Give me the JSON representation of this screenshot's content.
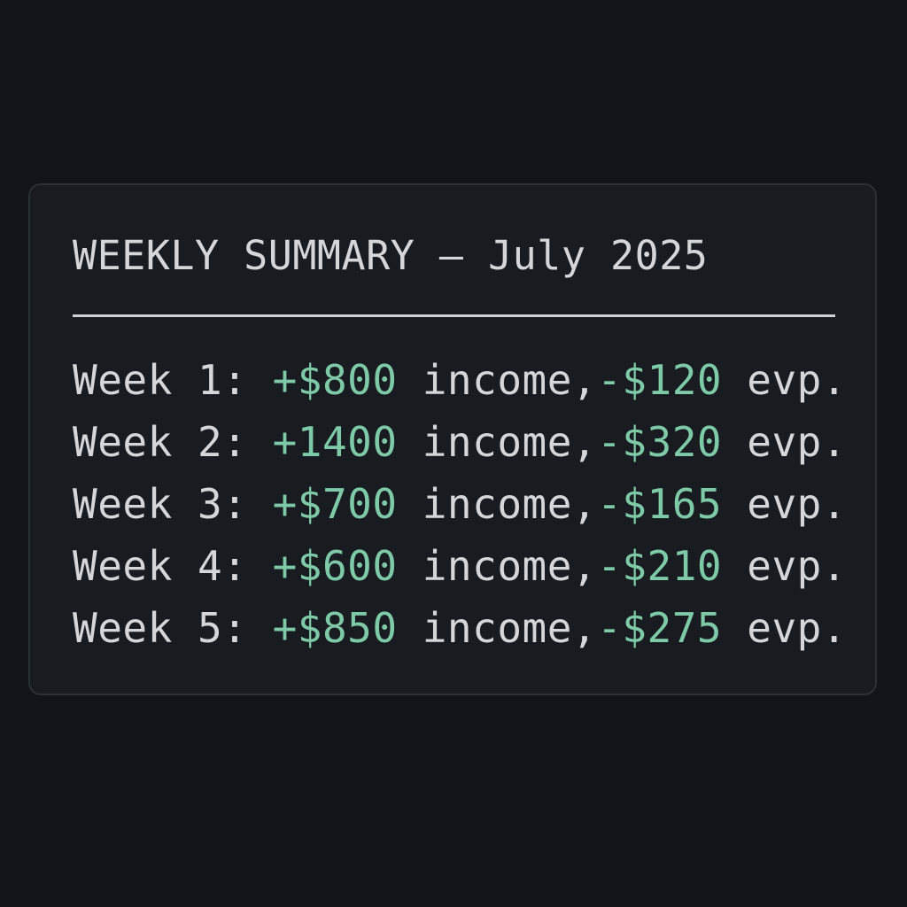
{
  "summary": {
    "title": "WEEKLY SUMMARY — July 2025",
    "rows": [
      {
        "week": "Week 1: ",
        "income": "+$800",
        "income_label": " income,",
        "expense": "-$120",
        "expense_label": " evp."
      },
      {
        "week": "Week 2: ",
        "income": "+1400",
        "income_label": " income,",
        "expense": "-$320",
        "expense_label": " evp."
      },
      {
        "week": "Week 3: ",
        "income": "+$700",
        "income_label": " income,",
        "expense": "-$165",
        "expense_label": " evp."
      },
      {
        "week": "Week 4: ",
        "income": "+$600",
        "income_label": " income,",
        "expense": "-$210",
        "expense_label": " evp."
      },
      {
        "week": "Week 5: ",
        "income": "+$850",
        "income_label": " income,",
        "expense": "-$275",
        "expense_label": " evp."
      }
    ]
  },
  "colors": {
    "background": "#111519",
    "card": "#181c20",
    "text": "#d4d6d9",
    "accent": "#7ec9a8"
  }
}
